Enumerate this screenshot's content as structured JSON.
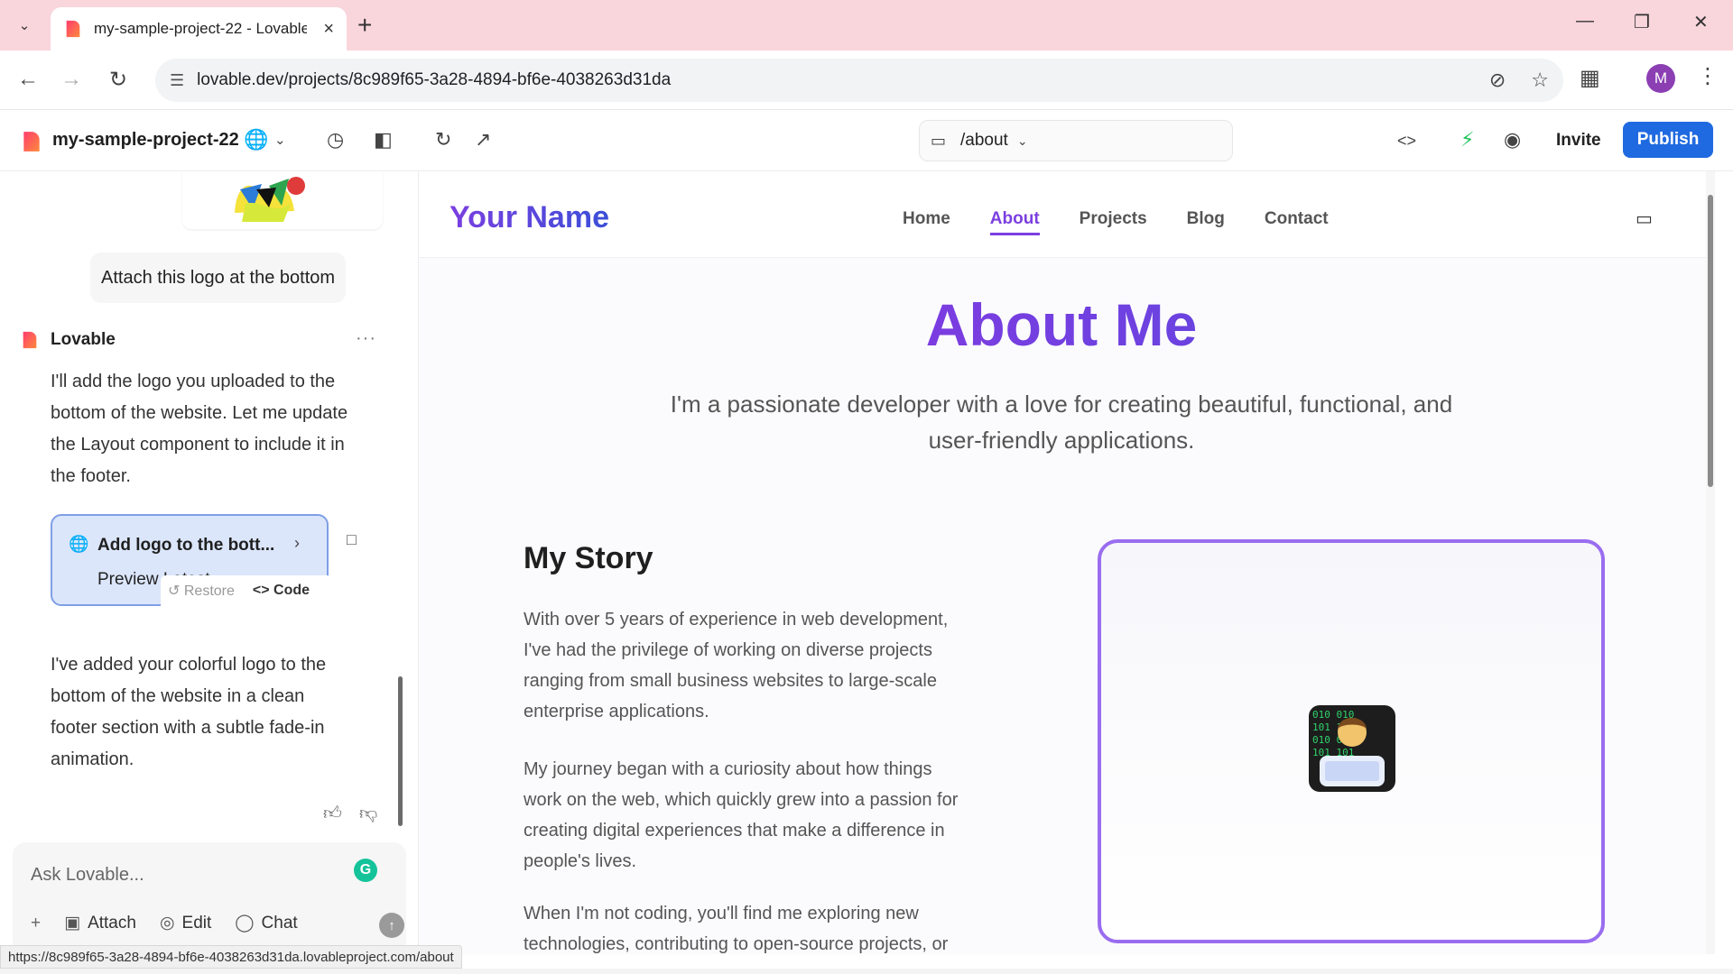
{
  "browser": {
    "tab_title": "my-sample-project-22 - Lovable",
    "url": "lovable.dev/projects/8c989f65-3a28-4894-bf6e-4038263d31da",
    "profile_initial": "M",
    "status_url": "https://8c989f65-3a28-4894-bf6e-4038263d31da.lovableproject.com/about"
  },
  "app": {
    "project_name": "my-sample-project-22",
    "route": "/about",
    "invite_label": "Invite",
    "publish_label": "Publish",
    "accent_color": "#1f6ae0"
  },
  "chat": {
    "user_message": "Attach this logo at the bottom",
    "assistant_name": "Lovable",
    "assistant_message_1_lines": [
      "I'll add the logo you uploaded to the",
      "bottom of the website. Let me update",
      "the Layout component to include it in",
      "the footer."
    ],
    "version_card": {
      "title": "Add logo to the bott...",
      "subtitle": "Preview Latest",
      "restore_label": "Restore",
      "code_label": "Code"
    },
    "assistant_message_2_lines": [
      "I've added your colorful logo to the",
      "bottom of the website in a clean",
      "footer section with a subtle fade-in",
      "animation."
    ],
    "input_placeholder": "Ask Lovable...",
    "tools": {
      "attach": "Attach",
      "edit": "Edit",
      "chat": "Chat"
    }
  },
  "preview": {
    "brand": "Your Name",
    "nav": [
      "Home",
      "About",
      "Projects",
      "Blog",
      "Contact"
    ],
    "active_nav": "About",
    "title": "About Me",
    "subtitle_lines": [
      "I'm a passionate developer with a love for creating beautiful, functional, and",
      "user-friendly applications."
    ],
    "story_title": "My Story",
    "story_paragraphs": [
      [
        "With over 5 years of experience in web development,",
        "I've had the privilege of working on diverse projects",
        "ranging from small business websites to large-scale",
        "enterprise applications."
      ],
      [
        "My journey began with a curiosity about how things",
        "work on the web, which quickly grew into a passion for",
        "creating digital experiences that make a difference in",
        "people's lives."
      ],
      [
        "When I'm not coding, you'll find me exploring new",
        "technologies, contributing to open-source projects, or"
      ]
    ],
    "frame_color": "#9a6df0",
    "title_gradient": [
      "#9b30e0",
      "#4a4fe0"
    ]
  }
}
